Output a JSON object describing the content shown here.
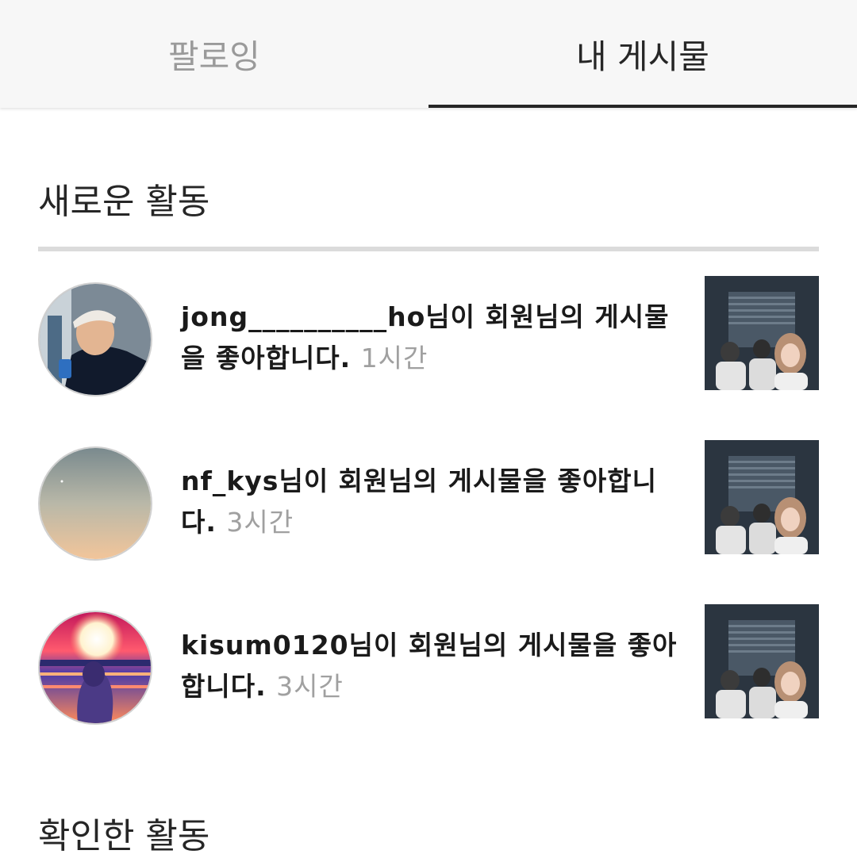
{
  "tabs": {
    "following": "팔로잉",
    "my_posts": "내 게시물",
    "active": "my_posts"
  },
  "sections": {
    "new_activity": "새로운 활동",
    "seen_activity": "확인한 활동"
  },
  "activities": [
    {
      "username": "jong__________ho",
      "message": "님이 회원님의 게시물을 좋아합니다.",
      "time": "1시간"
    },
    {
      "username": "nf_kys",
      "message": "님이 회원님의 게시물을 좋아합니다.",
      "time": "3시간"
    },
    {
      "username": "kisum0120",
      "message": "님이 회원님의 게시물을 좋아합니다.",
      "time": "3시간"
    }
  ],
  "colors": {
    "primary_text": "#262626",
    "secondary_text": "#9a9a9a",
    "divider": "#dbdbdb",
    "tab_bar_bg": "#f7f7f7"
  }
}
